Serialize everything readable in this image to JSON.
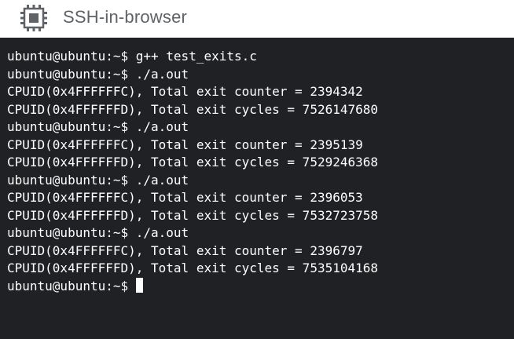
{
  "app": {
    "title": "SSH-in-browser",
    "icon": "chip-icon"
  },
  "terminal": {
    "lines": [
      "ubuntu@ubuntu:~$ g++ test_exits.c",
      "ubuntu@ubuntu:~$ ./a.out",
      "CPUID(0x4FFFFFFC), Total exit counter = 2394342",
      "CPUID(0x4FFFFFFD), Total exit cycles = 7526147680",
      "ubuntu@ubuntu:~$ ./a.out",
      "CPUID(0x4FFFFFFC), Total exit counter = 2395139",
      "CPUID(0x4FFFFFFD), Total exit cycles = 7529246368",
      "ubuntu@ubuntu:~$ ./a.out",
      "CPUID(0x4FFFFFFC), Total exit counter = 2396053",
      "CPUID(0x4FFFFFFD), Total exit cycles = 7532723758",
      "ubuntu@ubuntu:~$ ./a.out",
      "CPUID(0x4FFFFFFC), Total exit counter = 2396797",
      "CPUID(0x4FFFFFFD), Total exit cycles = 7535104168"
    ],
    "prompt": "ubuntu@ubuntu:~$ "
  },
  "colors": {
    "terminal_bg": "#202124",
    "terminal_fg": "#ffffff",
    "titlebar_bg": "#ffffff",
    "title_text": "#5f6368"
  }
}
